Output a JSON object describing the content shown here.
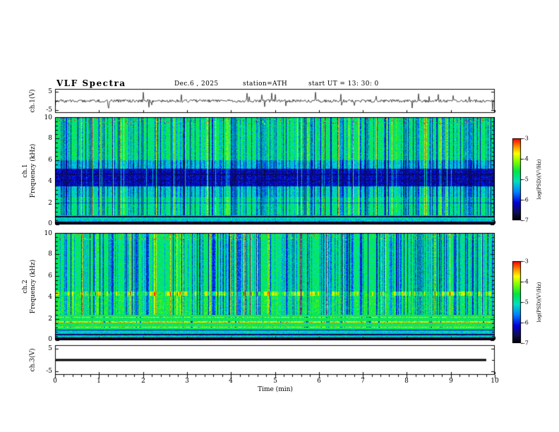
{
  "header": {
    "title": "VLF  Spectra",
    "date": "Dec.6  , 2025",
    "station": "station=ATH",
    "start_ut": "start UT  =   13: 30: 0"
  },
  "panels": {
    "ch1_waveform": {
      "ylabel": "ch.1(V)",
      "ytick_top": "5",
      "ytick_bottom": "-5"
    },
    "ch1_spectrogram": {
      "channel": "ch.1",
      "ylabel": "Frequency  (kHz)",
      "yticks": [
        "10",
        "8",
        "6",
        "4",
        "2",
        "0"
      ]
    },
    "ch2_spectrogram": {
      "channel": "ch.2",
      "ylabel": "Frequency  (kHz)",
      "yticks": [
        "10",
        "8",
        "6",
        "4",
        "2",
        "0"
      ]
    },
    "ch3_waveform": {
      "ylabel": "ch.3(V)",
      "ytick_top": "5",
      "ytick_bottom": "-5"
    }
  },
  "xaxis": {
    "label": "Time  (min)",
    "ticks": [
      "0",
      "1",
      "2",
      "3",
      "4",
      "5",
      "6",
      "7",
      "8",
      "9",
      "10"
    ]
  },
  "colorbar1": {
    "label": "log(PSD)(V²/Hz)",
    "ticks": [
      "-3",
      "-4",
      "-5",
      "-6",
      "-7"
    ]
  },
  "colorbar2": {
    "label": "log(PSD)(V²/Hz)",
    "ticks": [
      "-3",
      "-4",
      "-5",
      "-6",
      "-7"
    ]
  },
  "chart_data": [
    {
      "type": "line",
      "title": "ch.1(V) raw waveform",
      "xlabel": "Time (min)",
      "x_range": [
        0,
        10
      ],
      "ylabel": "ch.1(V)",
      "ylim": [
        -5,
        5
      ],
      "description": "Broadband noise centred on 0 V with dense impulsive sferic spikes reaching roughly ±3 to ±5 V throughout the 10-minute record"
    },
    {
      "type": "heatmap",
      "title": "ch.1 VLF spectrogram",
      "xlabel": "Time (min)",
      "x_range": [
        0,
        10
      ],
      "ylabel": "Frequency (kHz)",
      "y_range": [
        0,
        10
      ],
      "z_label": "log(PSD)(V²/Hz)",
      "z_range": [
        -7,
        -3
      ],
      "colormap": {
        "-3": "red",
        "-4": "yellow",
        "-5": "green",
        "-6": "blue",
        "-7": "black"
      },
      "features": [
        "green/cyan background near log(PSD) ≈ -5 above 1 kHz",
        "dense vertical dark-blue sferic streaks spanning 1-10 kHz at all times",
        "occasional bright yellow vertical columns and red speckles near 9.5-10 kHz",
        "broad dark-blue low-power band between about 3.8 and 5.2 kHz with darker horizontal sub-lines",
        "thin dark horizontal lines near 1.3 and 2.0 kHz",
        "near-black band below about 0.3 kHz and a dark line near 0.75 kHz"
      ]
    },
    {
      "type": "heatmap",
      "title": "ch.2 VLF spectrogram",
      "xlabel": "Time (min)",
      "x_range": [
        0,
        10
      ],
      "ylabel": "Frequency (kHz)",
      "y_range": [
        0,
        10
      ],
      "z_label": "log(PSD)(V²/Hz)",
      "z_range": [
        -7,
        -3
      ],
      "colormap": {
        "-3": "red",
        "-4": "yellow",
        "-5": "green",
        "-6": "blue",
        "-7": "black"
      },
      "features": [
        "green background near log(PSD) ≈ -5 with vertical dark-blue sferic streaks above ~2.5 kHz",
        "red speckles near 9.5-10 kHz",
        "segmented yellow horizontal band near 4.2-4.6 kHz",
        "bright yellow-green region between about 2.5 and 4.2 kHz",
        "dashed red/orange power-line harmonic lines near 1.25, 1.75 and 2.15 kHz",
        "near-black band below about 0.3 kHz and dark lines near 0.55 and 1.0 kHz"
      ]
    },
    {
      "type": "line",
      "title": "ch.3(V) raw waveform",
      "xlabel": "Time (min)",
      "x_range": [
        0,
        10
      ],
      "ylabel": "ch.3(V)",
      "ylim": [
        -5,
        5
      ],
      "description": "Completely flat thick line at 0 V for the entire record (channel inactive)"
    }
  ]
}
